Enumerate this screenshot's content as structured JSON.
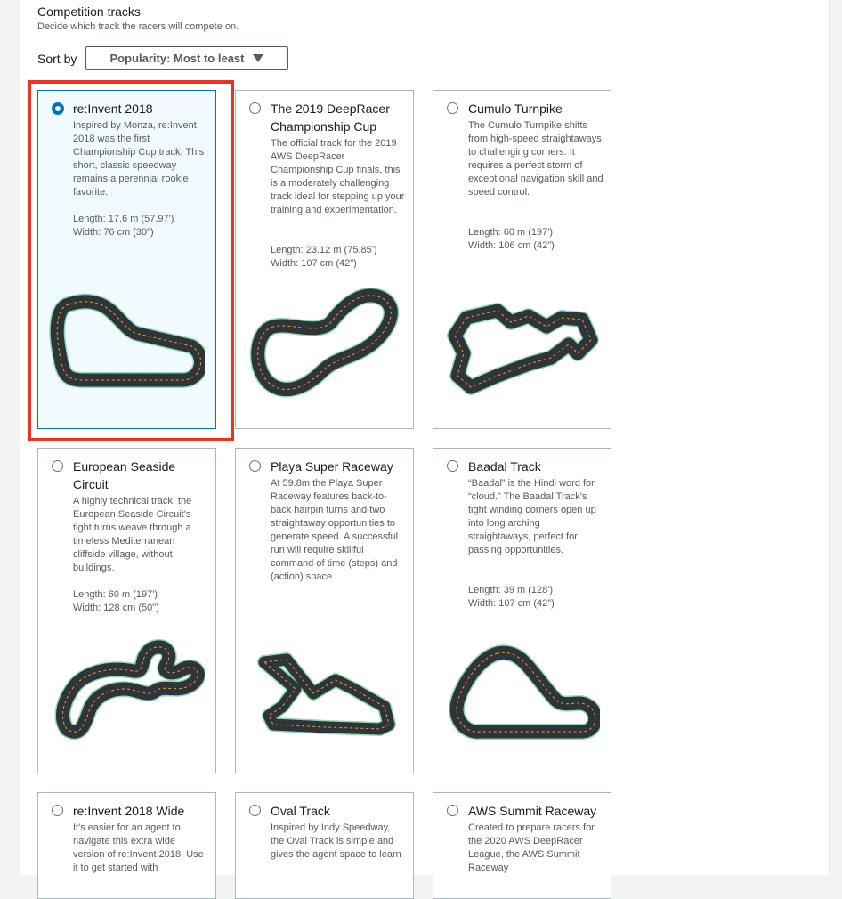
{
  "section": {
    "title": "Competition tracks",
    "description": "Decide which track the racers will compete on."
  },
  "sort": {
    "label": "Sort by",
    "value": "Popularity: Most to least"
  },
  "tracks": [
    {
      "name": "re:Invent 2018",
      "description": "Inspired by Monza, re:Invent 2018 was the first Championship Cup track. This short, classic speedway remains a perennial rookie favorite.",
      "length": "Length: 17.6 m (57.97')",
      "width": "Width: 76 cm (30\")",
      "selected": true
    },
    {
      "name": "The 2019 DeepRacer Championship Cup",
      "description": "The official track for the 2019 AWS DeepRacer Championship Cup finals, this is a moderately challenging track ideal for stepping up your training and experimentation.",
      "length": "Length: 23.12 m (75.85')",
      "width": "Width: 107 cm (42\")",
      "selected": false
    },
    {
      "name": "Cumulo Turnpike",
      "description": "The Cumulo Turnpike shifts from high-speed straightaways to challenging corners. It requires a perfect storm of exceptional navigation skill and speed control.",
      "length": "Length: 60 m (197')",
      "width": "Width: 106 cm (42\")",
      "selected": false
    },
    {
      "name": "European Seaside Circuit",
      "description": "A highly technical track, the European Seaside Circuit's tight turns weave through a timeless Mediterranean cliffside village, without buildings.",
      "length": "Length: 60 m (197')",
      "width": "Width: 128 cm (50\")",
      "selected": false
    },
    {
      "name": "Playa Super Raceway",
      "description": "At 59.8m the Playa Super Raceway features back-to-back hairpin turns and two straightaway opportunities to generate speed. A successful run will require skillful command of time (steps) and (action) space.",
      "length": "",
      "width": "",
      "selected": false
    },
    {
      "name": "Baadal Track",
      "description": "“Baadal” is the Hindi word for “cloud.” The Baadal Track's tight winding corners open up into long arching straightaways, perfect for passing opportunities.",
      "length": "Length: 39 m (128')",
      "width": "Width: 107 cm (42\")",
      "selected": false
    },
    {
      "name": "re:Invent 2018 Wide",
      "description": "It's easier for an agent to navigate this extra wide version of re:Invent 2018. Use it to get started with",
      "length": "",
      "width": "",
      "selected": false
    },
    {
      "name": "Oval Track",
      "description": "Inspired by Indy Speedway, the Oval Track is simple and gives the agent space to learn",
      "length": "",
      "width": "",
      "selected": false
    },
    {
      "name": "AWS Summit Raceway",
      "description": "Created to prepare racers for the 2020 AWS DeepRacer League, the AWS Summit Raceway",
      "length": "",
      "width": "",
      "selected": false
    }
  ],
  "colors": {
    "accent": "#0073bb",
    "highlight": "#ee3222",
    "track_asphalt": "#2e3438",
    "track_border": "#8fd9b6",
    "track_centerline": "#e0a030"
  }
}
